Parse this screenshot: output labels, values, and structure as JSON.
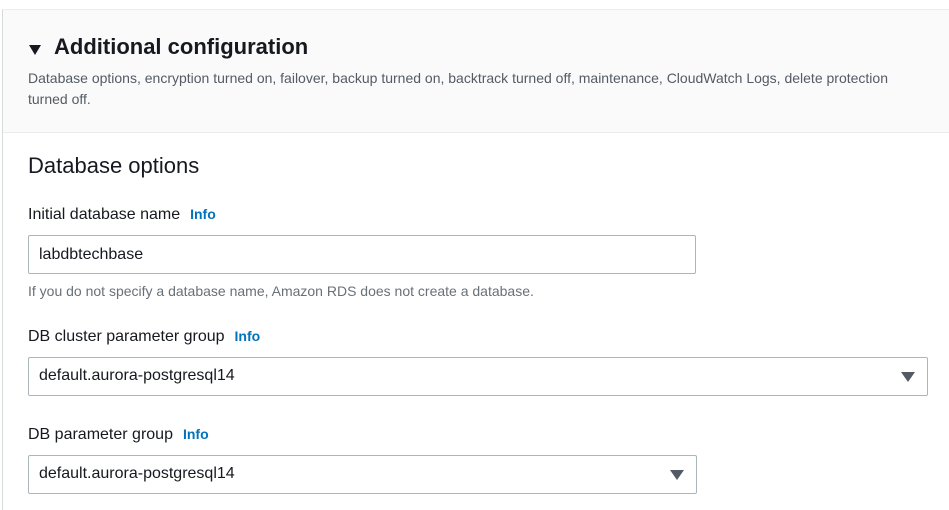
{
  "additional_config": {
    "title": "Additional configuration",
    "description": "Database options, encryption turned on, failover, backup turned on, backtrack turned off, maintenance, CloudWatch Logs, delete protection turned off."
  },
  "database_options": {
    "title": "Database options",
    "initial_db_name": {
      "label": "Initial database name",
      "info": "Info",
      "value": "labdbtechbase",
      "hint": "If you do not specify a database name, Amazon RDS does not create a database."
    },
    "cluster_param_group": {
      "label": "DB cluster parameter group",
      "info": "Info",
      "selected": "default.aurora-postgresql14"
    },
    "db_param_group": {
      "label": "DB parameter group",
      "info": "Info",
      "selected": "default.aurora-postgresql14"
    }
  },
  "icons": {
    "expand": "caret-down-icon",
    "dropdown": "dropdown-arrow-icon"
  },
  "colors": {
    "link": "#0073bb",
    "text": "#16191f",
    "secondary_text": "#545b64",
    "border": "#aab7b8",
    "header_bg": "#fafafa"
  }
}
